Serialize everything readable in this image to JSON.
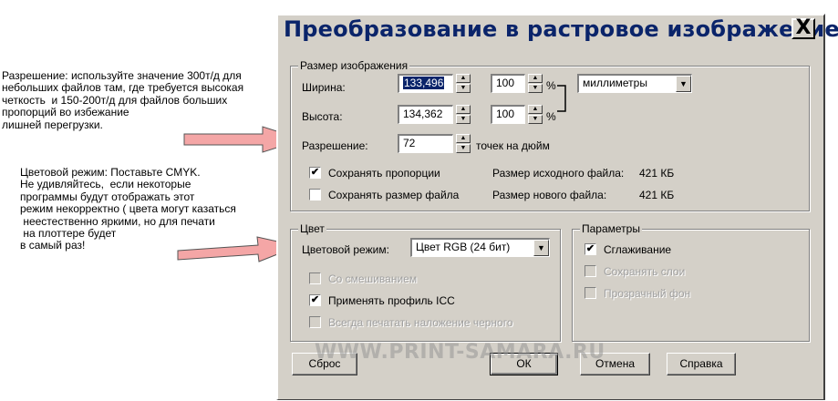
{
  "annotations": {
    "resolution_note": "Разрешение: используйте значение 300т/д для\nнебольших файлов там, где требуется высокая\nчеткость  и 150-200т/д для файлов больших\nпропорций во избежание\nлишней перегрузки.",
    "color_note": "Цветовой режим: Поставьте CMYK.\nНе удивляйтесь,  если некоторые\nпрограммы будут отображать этот\nрежим некорректно ( цвета могут казаться\n неестественно яркими, но для печати\n на плоттере будет\nв самый раз!",
    "arrow_color": "#f4a6a6"
  },
  "dialog": {
    "title": "Преобразование в растровое изображение",
    "close_glyph": "X",
    "accent_color": "#0a246a"
  },
  "image_size": {
    "group_label": "Размер изображения",
    "width_label": "Ширина:",
    "width_value": "133,496",
    "width_pct": "100",
    "height_label": "Высота:",
    "height_value": "134,362",
    "height_pct": "100",
    "pct_unit": "%",
    "units_value": "миллиметры",
    "resolution_label": "Разрешение:",
    "resolution_value": "72",
    "resolution_unit": "точек на дюйм",
    "keep_proportions_label": "Сохранять пропорции",
    "keep_proportions_checked": true,
    "keep_filesize_label": "Сохранять размер файла",
    "keep_filesize_checked": false,
    "orig_size_label": "Размер исходного файла:",
    "orig_size_value": "421 КБ",
    "new_size_label": "Размер нового файла:",
    "new_size_value": "421 КБ"
  },
  "color": {
    "group_label": "Цвет",
    "mode_label": "Цветовой режим:",
    "mode_value": "Цвет RGB (24 бит)",
    "dithering_label": "Со смешиванием",
    "icc_label": "Применять профиль ICC",
    "icc_checked": true,
    "overprint_label": "Всегда печатать наложение черного"
  },
  "options": {
    "group_label": "Параметры",
    "antialias_label": "Сглаживание",
    "antialias_checked": true,
    "keep_layers_label": "Сохранять слои",
    "transparent_bg_label": "Прозрачный фон"
  },
  "buttons": {
    "reset": "Сброс",
    "ok": "ОК",
    "cancel": "Отмена",
    "help": "Справка"
  },
  "watermark": "WWW.PRINT-SAMARA.RU"
}
